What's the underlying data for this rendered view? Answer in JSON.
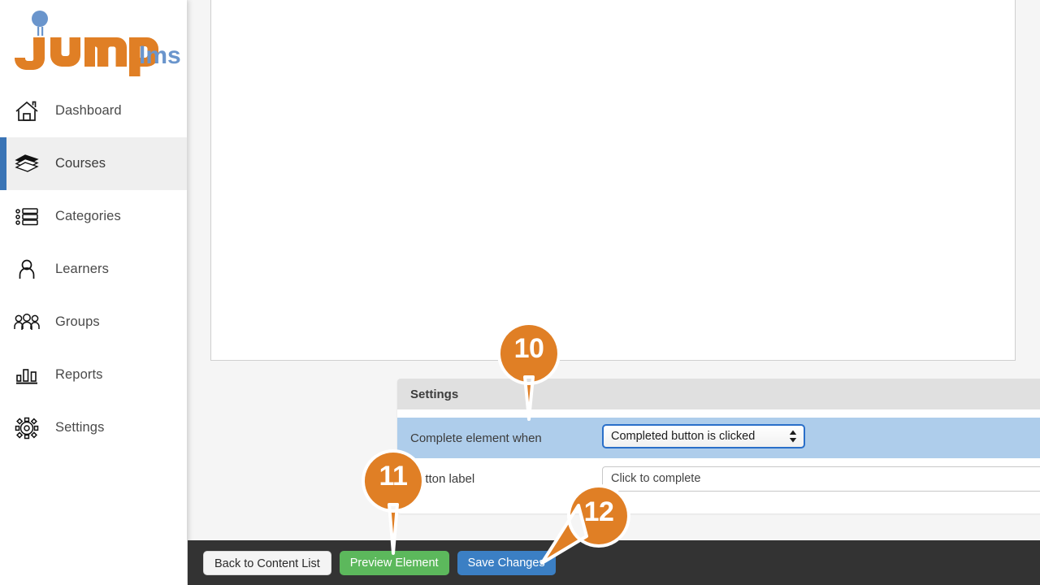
{
  "brand": {
    "name_primary": "jump",
    "name_secondary": "lms",
    "primary_color": "#e07f25",
    "secondary_color": "#6a95cc"
  },
  "sidebar": {
    "items": [
      {
        "label": "Dashboard",
        "icon": "home-icon",
        "active": false
      },
      {
        "label": "Courses",
        "icon": "books-icon",
        "active": true
      },
      {
        "label": "Categories",
        "icon": "list-icon",
        "active": false
      },
      {
        "label": "Learners",
        "icon": "user-icon",
        "active": false
      },
      {
        "label": "Groups",
        "icon": "users-group-icon",
        "active": false
      },
      {
        "label": "Reports",
        "icon": "bar-chart-icon",
        "active": false
      },
      {
        "label": "Settings",
        "icon": "gear-icon",
        "active": false
      }
    ],
    "active_indicator_color": "#3a74b5"
  },
  "main": {
    "editor_panel": {
      "content": ""
    },
    "settings": {
      "header_title": "Settings",
      "rows": [
        {
          "label": "Complete element when",
          "control": "select",
          "value": "Completed button is clicked",
          "highlighted": true
        },
        {
          "label": "Button label",
          "control": "text",
          "value": "Click to complete",
          "placeholder": "",
          "highlighted": false
        }
      ]
    }
  },
  "footer": {
    "buttons": [
      {
        "label": "Back to Content List",
        "style": "default"
      },
      {
        "label": "Preview Element",
        "style": "success"
      },
      {
        "label": "Save Changes",
        "style": "primary"
      }
    ],
    "background_color": "#333333"
  },
  "callouts": {
    "marker_color": "#e07f25",
    "items": [
      {
        "number": "10",
        "target": "complete-element-when-select"
      },
      {
        "number": "11",
        "target": "preview-element-button"
      },
      {
        "number": "12",
        "target": "save-changes-button"
      }
    ]
  }
}
